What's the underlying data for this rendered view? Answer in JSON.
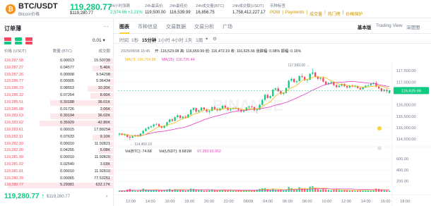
{
  "header": {
    "coin_glyph": "₿",
    "pair": "BTC/USDT",
    "pair_sub": "Bitcoin价格",
    "price": "119,280.77",
    "price_usd": "$119,280.77",
    "stats": [
      {
        "label": "24小时涨跌",
        "value": "2,574.66 +2.21%",
        "green": true
      },
      {
        "label": "24h最高价",
        "value": "119,500.00",
        "green": false
      },
      {
        "label": "24h最低价",
        "value": "116,539.99",
        "green": false
      },
      {
        "label": "24h成交量(BTC)",
        "value": "16,856.75",
        "green": false
      },
      {
        "label": "24h成交额(USDT)",
        "value": "1,758,412,227.17",
        "green": false
      }
    ],
    "tags_label": "币种标签",
    "tags": [
      "POW",
      "Payments",
      "成交量",
      "热门榜",
      "价格保护"
    ]
  },
  "orderbook": {
    "title": "订单薄",
    "more": "···",
    "step": "0.01 ▾",
    "cols": [
      "价格 (USDT)",
      "数量 (BTC)",
      "成交额"
    ],
    "rows": [
      {
        "price": "119,287.58",
        "qty": "0.00013",
        "total": "15.50739",
        "depth": 0.1
      },
      {
        "price": "119,287.27",
        "qty": "0.04577",
        "total": "5.46K",
        "depth": 0.2
      },
      {
        "price": "119,287.26",
        "qty": "0.00008",
        "total": "9.54298",
        "depth": 0.05
      },
      {
        "price": "119,286.77",
        "qty": "0.00005",
        "total": "5.96434",
        "depth": 0.05
      },
      {
        "price": "119,286.73",
        "qty": "0.08553",
        "total": "10.20K",
        "depth": 0.25
      },
      {
        "price": "119,286.32",
        "qty": "0.07264",
        "total": "8.66K",
        "depth": 0.22
      },
      {
        "price": "119,285.51",
        "qty": "0.30188",
        "total": "36.01K",
        "depth": 0.6
      },
      {
        "price": "119,285.08",
        "qty": "0.01726",
        "total": "2.06K",
        "depth": 0.12
      },
      {
        "price": "119,283.63",
        "qty": "0.30194",
        "total": "36.02K",
        "depth": 0.6
      },
      {
        "price": "119,283.62",
        "qty": "0.35929",
        "total": "42.86K",
        "depth": 0.7
      },
      {
        "price": "119,283.61",
        "qty": "0.00015",
        "total": "17.89254",
        "depth": 0.06
      },
      {
        "price": "119,282.11",
        "qty": "0.07633",
        "total": "9.10K",
        "depth": 0.2
      },
      {
        "price": "119,282.10",
        "qty": "0.00010",
        "total": "11.92821",
        "depth": 0.05
      },
      {
        "price": "119,282.00",
        "qty": "0.04255",
        "total": "5.08K",
        "depth": 0.15
      },
      {
        "price": "119,281.99",
        "qty": "0.00010",
        "total": "11.92820",
        "depth": 0.05
      },
      {
        "price": "119,281.02",
        "qty": "0.02540",
        "total": "3.03K",
        "depth": 0.1
      },
      {
        "price": "119,281.01",
        "qty": "0.00010",
        "total": "11.92810",
        "depth": 0.05
      },
      {
        "price": "119,280.78",
        "qty": "0.00065",
        "total": "77.53251",
        "depth": 0.08
      },
      {
        "price": "119,280.77",
        "qty": "5.29981",
        "total": "632.17K",
        "depth": 1.0
      }
    ],
    "last_price": "119,280.77 ↑",
    "last_price_usd": "$119,280.77",
    "arrow": "›"
  },
  "tabs": [
    "图表",
    "币种信息",
    "交易数据",
    "交易分析",
    "广场"
  ],
  "views": [
    "基本版",
    "Trading View",
    "深度图"
  ],
  "toolbar": [
    "时间",
    "1秒",
    "15分钟",
    "1小时",
    "4小时",
    "1天",
    "1周",
    "▾",
    "⚙"
  ],
  "chart_legend": {
    "date": "2025/08/08 16:45",
    "ohlc": "开: 116,523.08 高: 116,659.99 低: 116,472.19 收: 116,625.66 涨跌幅: 0.08% 振幅: 0.16%",
    "ma7": "MA(7): 116,764.88",
    "ma25": "MA(25): 116,726.44",
    "vol": "Vol(BTC): 74.68",
    "vol_usdt": "Vol(USDT): 8.681M",
    "vol_ma": "97.283  93.952"
  },
  "watermark": "BINANCE",
  "colors": {
    "up": "#0ecb81",
    "down": "#f6465d",
    "ma7": "#f0b90b",
    "ma25": "#e73cc0",
    "ma99": "#7b1fa2"
  },
  "chart_data": {
    "type": "candlestick",
    "x_labels": [
      "12:00",
      "14:00",
      "16:00",
      "18:00",
      "20:00",
      "22:00",
      "08/08",
      "04:00",
      "06:00",
      "08:00",
      "10:00",
      "12:00",
      "14:00",
      "16:00",
      "18:00"
    ],
    "y_ticks": [
      114500,
      115000,
      115500,
      116000,
      116500,
      117000,
      117500
    ],
    "ylim": [
      114350,
      117750
    ],
    "vol_ticks": [
      200,
      400,
      600
    ],
    "vol_tick_labels": [
      "200.00",
      "400.00",
      "600.00"
    ],
    "vol_max": 640,
    "current_price": 116625.66,
    "current_label": "116,625.66",
    "low_label": "114,450.10",
    "high_label": "117,590.00",
    "candles": [
      [
        114700,
        114780,
        114630,
        114740,
        20
      ],
      [
        114740,
        114760,
        114650,
        114690,
        18
      ],
      [
        114690,
        114750,
        114640,
        114700,
        25
      ],
      [
        114700,
        114720,
        114540,
        114600,
        40
      ],
      [
        114600,
        114640,
        114450,
        114560,
        55
      ],
      [
        114560,
        114650,
        114540,
        114620,
        30
      ],
      [
        114620,
        114700,
        114600,
        114660,
        22
      ],
      [
        114660,
        114700,
        114580,
        114620,
        20
      ],
      [
        114620,
        114760,
        114600,
        114740,
        35
      ],
      [
        114740,
        114900,
        114700,
        114860,
        60
      ],
      [
        114860,
        115000,
        114820,
        114950,
        45
      ],
      [
        114950,
        115060,
        114900,
        115020,
        40
      ],
      [
        115020,
        115100,
        114980,
        115060,
        30
      ],
      [
        115060,
        115180,
        115000,
        115140,
        35
      ],
      [
        115140,
        115220,
        115080,
        115160,
        30
      ],
      [
        115160,
        115200,
        115020,
        115060,
        28
      ],
      [
        115060,
        115100,
        114960,
        115000,
        25
      ],
      [
        115000,
        115120,
        114960,
        115080,
        30
      ],
      [
        115080,
        115260,
        115040,
        115240,
        45
      ],
      [
        115240,
        115400,
        115200,
        115360,
        55
      ],
      [
        115360,
        115420,
        115240,
        115300,
        35
      ],
      [
        115300,
        115500,
        115280,
        115460,
        50
      ],
      [
        115460,
        115600,
        115420,
        115540,
        40
      ],
      [
        115540,
        115560,
        115380,
        115420,
        35
      ],
      [
        115420,
        115520,
        115360,
        115480,
        30
      ],
      [
        115480,
        115540,
        115400,
        115440,
        25
      ],
      [
        115440,
        115600,
        115420,
        115580,
        35
      ],
      [
        115580,
        115820,
        115540,
        115780,
        60
      ],
      [
        115780,
        115900,
        115700,
        115860,
        55
      ],
      [
        115860,
        115880,
        115640,
        115700,
        45
      ],
      [
        115700,
        115800,
        115640,
        115760,
        30
      ],
      [
        115760,
        115920,
        115720,
        115880,
        40
      ],
      [
        115880,
        115900,
        115760,
        115800,
        25
      ],
      [
        115800,
        115840,
        115660,
        115700,
        28
      ],
      [
        115700,
        115780,
        115600,
        115740,
        30
      ],
      [
        115740,
        115940,
        115700,
        115900,
        45
      ],
      [
        115900,
        115960,
        115780,
        115820,
        30
      ],
      [
        115820,
        115860,
        115700,
        115760,
        25
      ],
      [
        115760,
        115880,
        115720,
        115840,
        28
      ],
      [
        115840,
        116000,
        115800,
        115960,
        40
      ],
      [
        115960,
        116000,
        115840,
        115880,
        28
      ],
      [
        115880,
        115920,
        115740,
        115780,
        26
      ],
      [
        115780,
        115860,
        115700,
        115820,
        24
      ],
      [
        115820,
        115900,
        115780,
        115860,
        20
      ],
      [
        115860,
        115920,
        115800,
        115840,
        18
      ],
      [
        115840,
        115880,
        115740,
        115780,
        20
      ],
      [
        115780,
        115800,
        115640,
        115700,
        26
      ],
      [
        115700,
        115780,
        115660,
        115740,
        22
      ],
      [
        115740,
        115900,
        115720,
        115880,
        30
      ],
      [
        115880,
        115960,
        115840,
        115920,
        28
      ],
      [
        115920,
        115980,
        115860,
        115900,
        22
      ],
      [
        115900,
        115940,
        115700,
        115760,
        35
      ],
      [
        115760,
        115840,
        115620,
        115800,
        40
      ],
      [
        115800,
        116040,
        115780,
        116000,
        55
      ],
      [
        116000,
        116260,
        115980,
        116220,
        65
      ],
      [
        116220,
        116500,
        116180,
        116440,
        70
      ],
      [
        116440,
        116480,
        116260,
        116300,
        45
      ],
      [
        116300,
        116420,
        116260,
        116380,
        35
      ],
      [
        116380,
        116700,
        116360,
        116660,
        60
      ],
      [
        116660,
        116760,
        116600,
        116720,
        40
      ],
      [
        116720,
        116800,
        116560,
        116600,
        35
      ],
      [
        116600,
        116640,
        116420,
        116480,
        40
      ],
      [
        116480,
        116560,
        116400,
        116520,
        30
      ],
      [
        116520,
        116760,
        116500,
        116740,
        45
      ],
      [
        116740,
        117100,
        116720,
        117060,
        90
      ],
      [
        117060,
        117200,
        117000,
        117140,
        70
      ],
      [
        117140,
        117160,
        116960,
        117000,
        45
      ],
      [
        117000,
        117080,
        116900,
        117040,
        40
      ],
      [
        117040,
        117300,
        117020,
        117260,
        85
      ],
      [
        117260,
        117360,
        117180,
        117220,
        60
      ],
      [
        117220,
        117260,
        117040,
        117080,
        55
      ],
      [
        117080,
        117140,
        116960,
        117100,
        45
      ],
      [
        117100,
        117400,
        117080,
        117360,
        95
      ],
      [
        117360,
        117590,
        117300,
        117420,
        105
      ],
      [
        117420,
        117440,
        117180,
        117240,
        70
      ],
      [
        117240,
        117280,
        117080,
        117140,
        55
      ],
      [
        117140,
        117220,
        117060,
        117180,
        40
      ],
      [
        117180,
        117240,
        116980,
        117020,
        50
      ],
      [
        117020,
        117060,
        116860,
        116900,
        45
      ],
      [
        116900,
        117000,
        116860,
        116960,
        38
      ],
      [
        116960,
        117040,
        116900,
        117000,
        30
      ],
      [
        117000,
        117040,
        116820,
        116860,
        45
      ],
      [
        116860,
        116920,
        116720,
        116780,
        50
      ],
      [
        116780,
        116880,
        116760,
        116840,
        35
      ],
      [
        116840,
        116960,
        116800,
        116920,
        30
      ],
      [
        116920,
        116940,
        116780,
        116820,
        35
      ],
      [
        116820,
        116840,
        116700,
        116760,
        30
      ],
      [
        116760,
        116880,
        116720,
        116840,
        25
      ],
      [
        116840,
        116900,
        116760,
        116800,
        28
      ],
      [
        116800,
        116860,
        116740,
        116820,
        22
      ],
      [
        116820,
        116840,
        116700,
        116740,
        30
      ],
      [
        116740,
        116780,
        116640,
        116680,
        35
      ],
      [
        116680,
        116800,
        116660,
        116760,
        28
      ],
      [
        116760,
        116880,
        116740,
        116840,
        30
      ],
      [
        116840,
        116900,
        116780,
        116860,
        25
      ],
      [
        116860,
        116960,
        116820,
        116920,
        30
      ],
      [
        116920,
        117000,
        116880,
        116960,
        35
      ],
      [
        116960,
        117040,
        116760,
        116800,
        60
      ],
      [
        116800,
        116840,
        116680,
        116720,
        55
      ],
      [
        116720,
        116760,
        116560,
        116600,
        45
      ],
      [
        116600,
        116700,
        116560,
        116660,
        30
      ],
      [
        116660,
        116720,
        116520,
        116600,
        28
      ],
      [
        116523,
        116660,
        116472,
        116626,
        20
      ]
    ]
  }
}
